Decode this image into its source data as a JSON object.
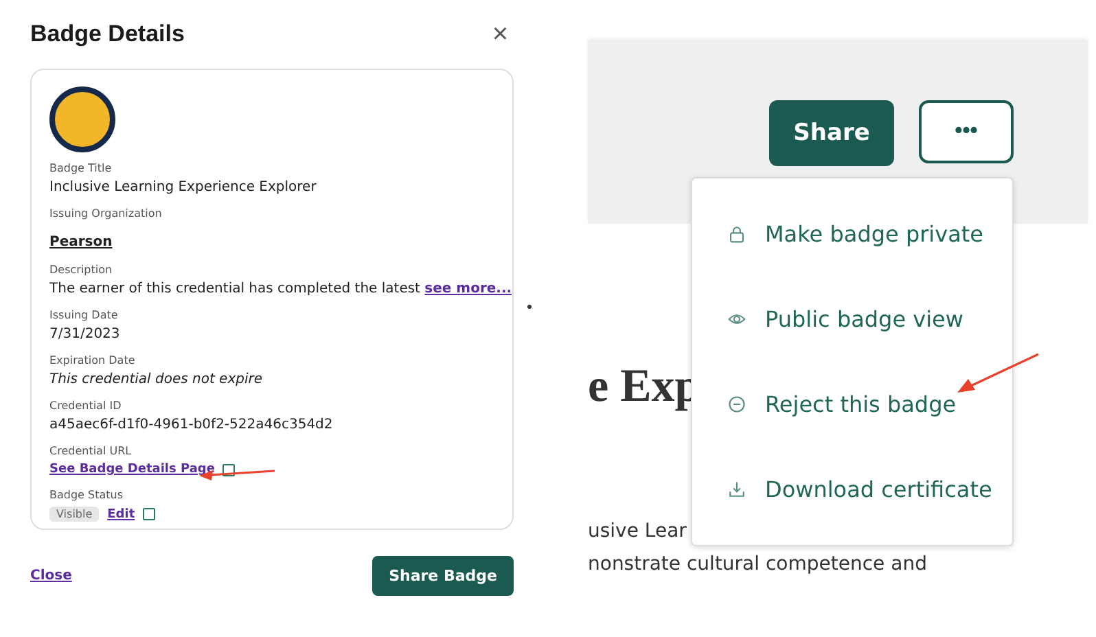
{
  "dialog": {
    "title": "Badge Details",
    "close_icon": "×",
    "fields": [
      {
        "kind": "text",
        "label": "Badge Title",
        "value": "Inclusive Learning Experience Explorer"
      },
      {
        "kind": "org",
        "label": "Issuing Organization",
        "value": "Pearson"
      },
      {
        "kind": "desc",
        "label": "Description",
        "value": "The earner of this credential has completed the latest",
        "link": "see more..."
      },
      {
        "kind": "text",
        "label": "Issuing Date",
        "value": "7/31/2023"
      },
      {
        "kind": "italic",
        "label": "Expiration Date",
        "value": "This credential does not expire"
      },
      {
        "kind": "text",
        "label": "Credential ID",
        "value": "a45aec6f-d1f0-4961-b0f2-522a46c354d2"
      },
      {
        "kind": "url",
        "label": "Credential URL",
        "value": "See Badge Details Page"
      },
      {
        "kind": "status",
        "label": "Badge Status",
        "value": "Visible",
        "link": "Edit"
      }
    ],
    "footer": {
      "close": "Close",
      "share": "Share Badge"
    }
  },
  "page": {
    "share": "Share",
    "more": "•••",
    "menu": [
      {
        "kind": "lock",
        "label": "Make badge private"
      },
      {
        "kind": "eye",
        "label": "Public badge view"
      },
      {
        "kind": "minus",
        "label": "Reject this badge"
      },
      {
        "kind": "download",
        "label": "Download certificate"
      }
    ],
    "heading": "e Exp",
    "lines": [
      "usive Lear",
      "nonstrate cultural competence and"
    ]
  }
}
